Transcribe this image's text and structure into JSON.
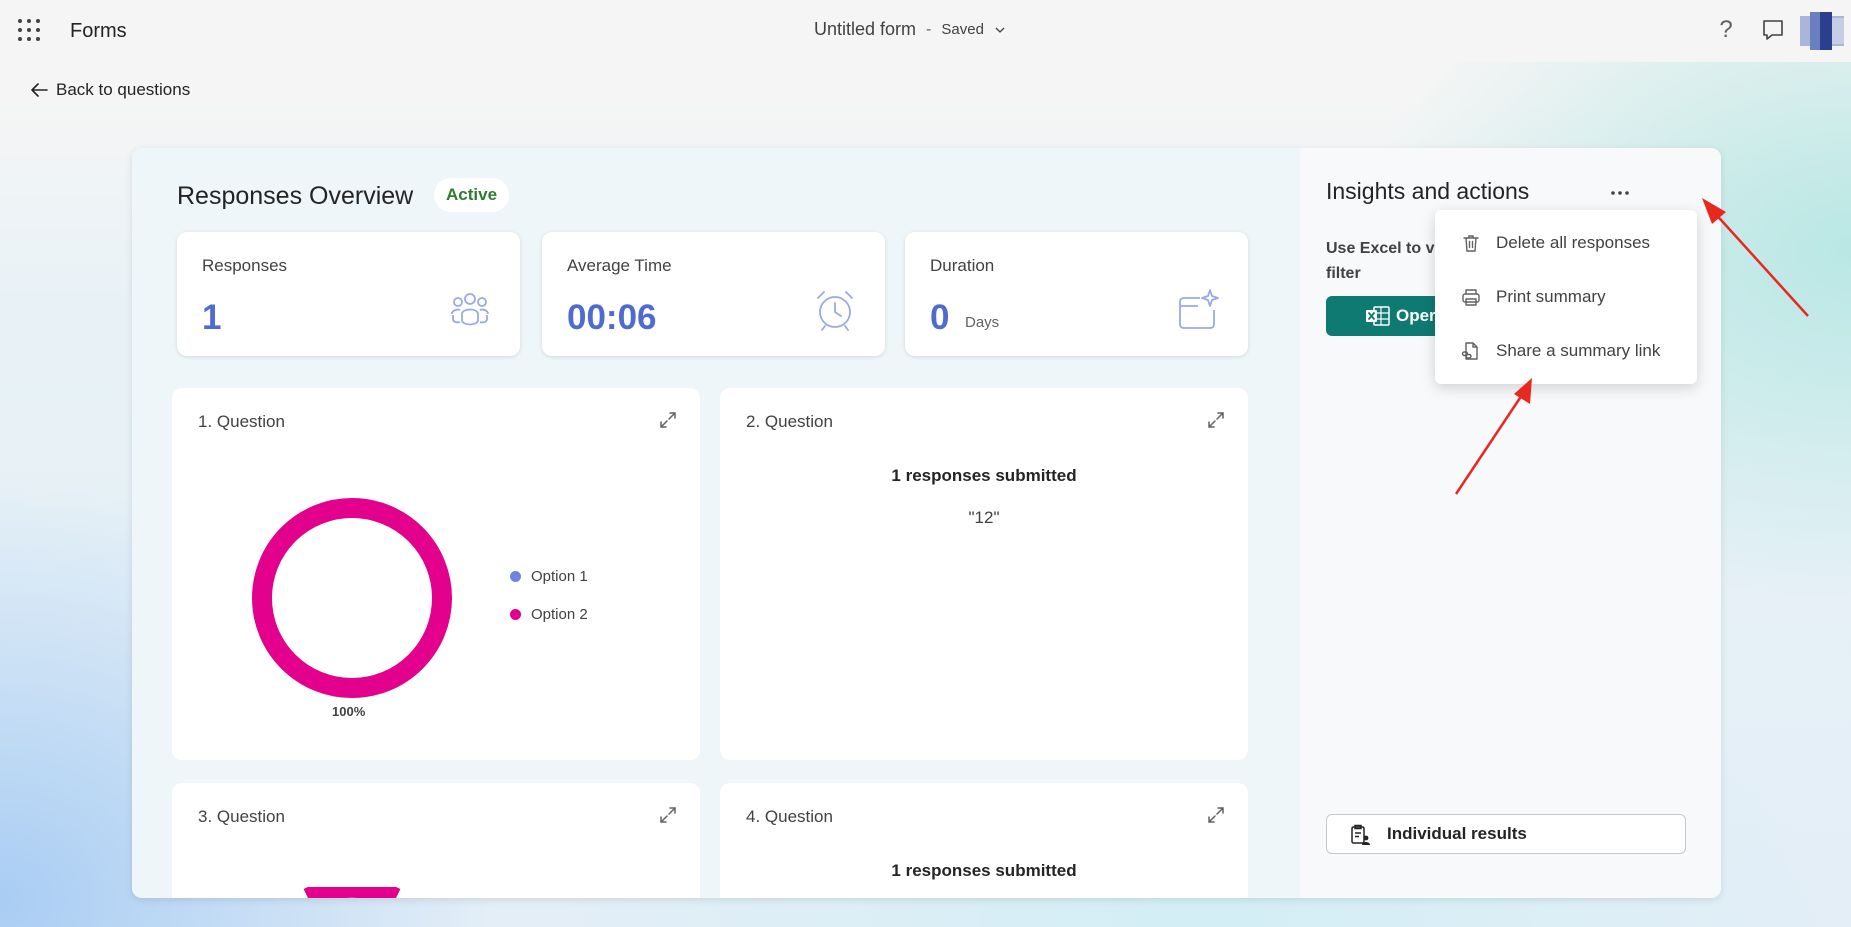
{
  "topbar": {
    "app_name": "Forms",
    "form_title": "Untitled form",
    "separator": "-",
    "save_status": "Saved",
    "help_glyph": "?"
  },
  "nav": {
    "back_label": "Back to questions"
  },
  "overview": {
    "title": "Responses Overview",
    "status_badge": "Active",
    "stats": {
      "responses": {
        "label": "Responses",
        "value": "1",
        "icon": "people-icon"
      },
      "average_time": {
        "label": "Average Time",
        "value": "00:06",
        "icon": "alarm-clock-icon"
      },
      "duration": {
        "label": "Duration",
        "value": "0",
        "unit": "Days",
        "icon": "calendar-sparkle-icon"
      }
    }
  },
  "questions": [
    {
      "title": "1. Question",
      "type": "donut"
    },
    {
      "title": "2. Question",
      "type": "text",
      "count_text": "1 responses submitted",
      "response": "\"12\""
    },
    {
      "title": "3. Question",
      "type": "donut"
    },
    {
      "title": "4. Question",
      "type": "text",
      "count_text": "1 responses submitted"
    }
  ],
  "chart_data": {
    "type": "pie",
    "categories": [
      "Option 1",
      "Option 2"
    ],
    "values": [
      0,
      100
    ],
    "colors": [
      "#6e84e0",
      "#e2008c"
    ],
    "data_label": "100%",
    "legend": "right"
  },
  "insights": {
    "title": "Insights and actions",
    "text": "Use Excel to v and sort, filter",
    "excel_button_label": "Oper",
    "individual_results_label": "Individual results"
  },
  "menu": {
    "items": [
      {
        "label": "Delete all responses",
        "icon": "trash-icon"
      },
      {
        "label": "Print summary",
        "icon": "printer-icon"
      },
      {
        "label": "Share a summary link",
        "icon": "document-link-icon"
      }
    ]
  },
  "colors": {
    "accent_blue": "#4f6bd1",
    "excel_green": "#0f7a72",
    "active_green": "#2e7d32",
    "annotation_red": "#e8281f"
  }
}
